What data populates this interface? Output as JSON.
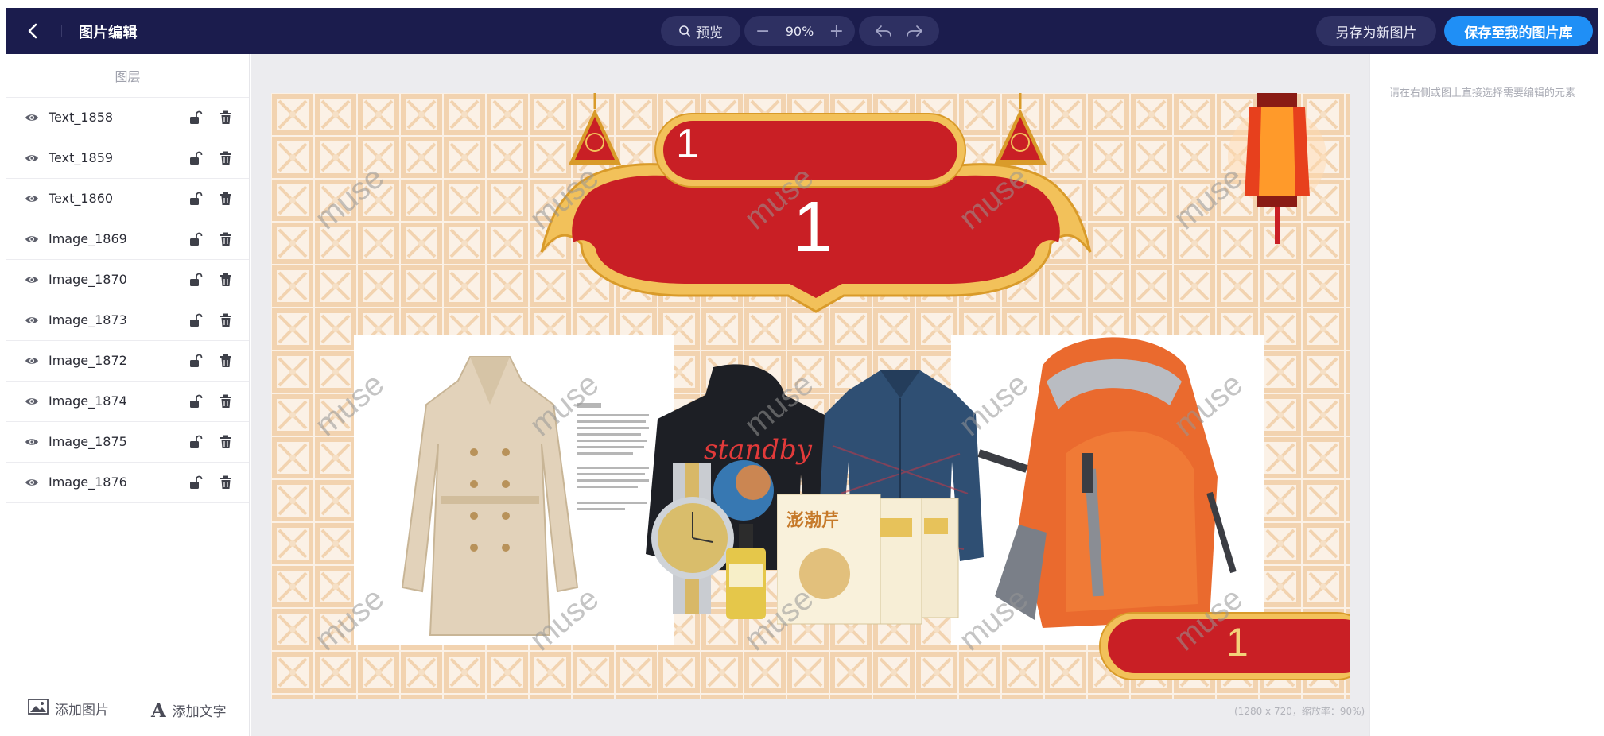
{
  "header": {
    "title": "图片编辑",
    "preview_label": "预览",
    "zoom_minus": "−",
    "zoom_value": "90%",
    "zoom_plus": "+",
    "save_as_new_label": "另存为新图片",
    "save_to_library_label": "保存至我的图片库"
  },
  "layers": {
    "header": "图层",
    "items": [
      {
        "name": "Text_1858"
      },
      {
        "name": "Text_1859"
      },
      {
        "name": "Text_1860"
      },
      {
        "name": "Image_1869"
      },
      {
        "name": "Image_1870"
      },
      {
        "name": "Image_1873"
      },
      {
        "name": "Image_1872"
      },
      {
        "name": "Image_1874"
      },
      {
        "name": "Image_1875"
      },
      {
        "name": "Image_1876"
      }
    ],
    "add_image_label": "添加图片",
    "add_text_label": "添加文字"
  },
  "canvas": {
    "info": "(1280 x 720，缩放率：90%)",
    "banner_top_text": "1",
    "banner_main_text": "1",
    "banner_bottom_text": "1",
    "watermark": "muse"
  },
  "right_panel": {
    "hint": "请在右侧或图上直接选择需要编辑的元素"
  },
  "colors": {
    "topbar": "#1b1c4d",
    "primary": "#1f8ff6",
    "banner_red": "#c91f25",
    "banner_gold": "#f2c15a"
  }
}
